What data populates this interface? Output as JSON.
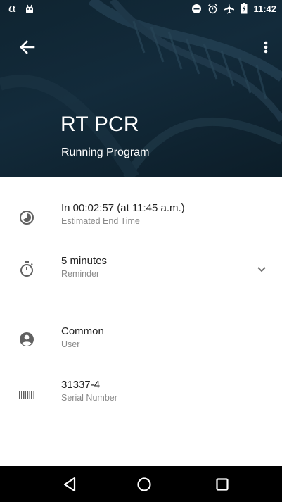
{
  "status_bar": {
    "time": "11:42",
    "left_icons": [
      "alpha-icon",
      "android-icon"
    ],
    "right_icons": [
      "do-not-disturb-icon",
      "alarm-icon",
      "airplane-icon",
      "battery-charging-icon"
    ]
  },
  "header": {
    "title": "RT PCR",
    "subtitle": "Running Program",
    "background_color": "#132b3b"
  },
  "details": [
    {
      "icon": "timelapse-icon",
      "primary": "In 00:02:57 (at 11:45 a.m.)",
      "secondary": "Estimated End Time"
    },
    {
      "icon": "timer-icon",
      "primary": "5 minutes",
      "secondary": "Reminder",
      "dropdown_icon": "chevron-down-icon"
    },
    {
      "icon": "account-circle-icon",
      "primary": "Common",
      "secondary": "User"
    },
    {
      "icon": "barcode-icon",
      "primary": "31337-4",
      "secondary": "Serial Number"
    }
  ],
  "nav_bar": {
    "buttons": [
      "back-triangle-icon",
      "home-circle-icon",
      "recents-square-icon"
    ]
  }
}
